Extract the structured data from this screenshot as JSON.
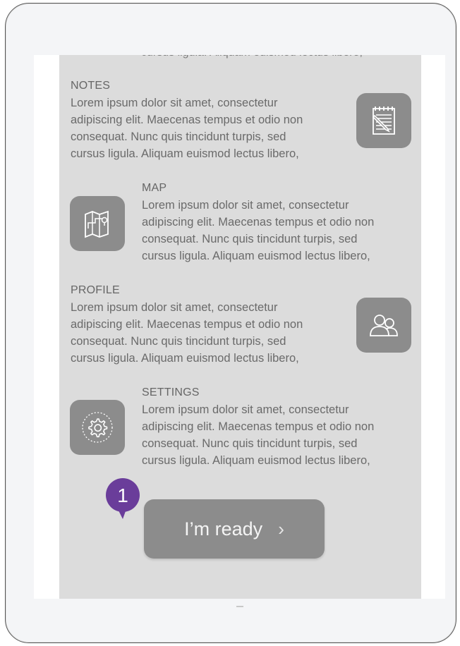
{
  "cutoff_text": "cursus ligula. Aliquam euismod lectus libero,",
  "sections": [
    {
      "title": "NOTES",
      "lines": [
        "Lorem ipsum dolor sit amet, consectetur",
        "adipiscing elit. Maecenas tempus et odio non",
        "consequat. Nunc quis tincidunt turpis, sed",
        "cursus ligula. Aliquam euismod lectus libero,"
      ],
      "icon": "notepad-icon"
    },
    {
      "title": "MAP",
      "lines": [
        "Lorem ipsum dolor sit amet, consectetur",
        "adipiscing elit. Maecenas tempus et odio non",
        "consequat. Nunc quis tincidunt turpis, sed",
        "cursus ligula. Aliquam euismod lectus libero,"
      ],
      "icon": "map-icon"
    },
    {
      "title": "PROFILE",
      "lines": [
        "Lorem ipsum dolor sit amet, consectetur",
        "adipiscing elit. Maecenas tempus et odio non",
        "consequat. Nunc quis tincidunt turpis, sed",
        "cursus ligula. Aliquam euismod lectus libero,"
      ],
      "icon": "users-icon"
    },
    {
      "title": "SETTINGS",
      "lines": [
        "Lorem ipsum dolor sit amet, consectetur",
        "adipiscing elit. Maecenas tempus et odio non",
        "consequat. Nunc quis tincidunt turpis, sed",
        "cursus ligula. Aliquam euismod lectus libero,"
      ],
      "icon": "gear-icon"
    }
  ],
  "ready_button": {
    "label": "I’m ready",
    "chevron": "›"
  },
  "step_badge": {
    "number": "1",
    "color": "#6a3d9a"
  },
  "colors": {
    "tile": "#8c8c8c",
    "panel": "#dcdcdc",
    "badge": "#6a3d9a"
  }
}
